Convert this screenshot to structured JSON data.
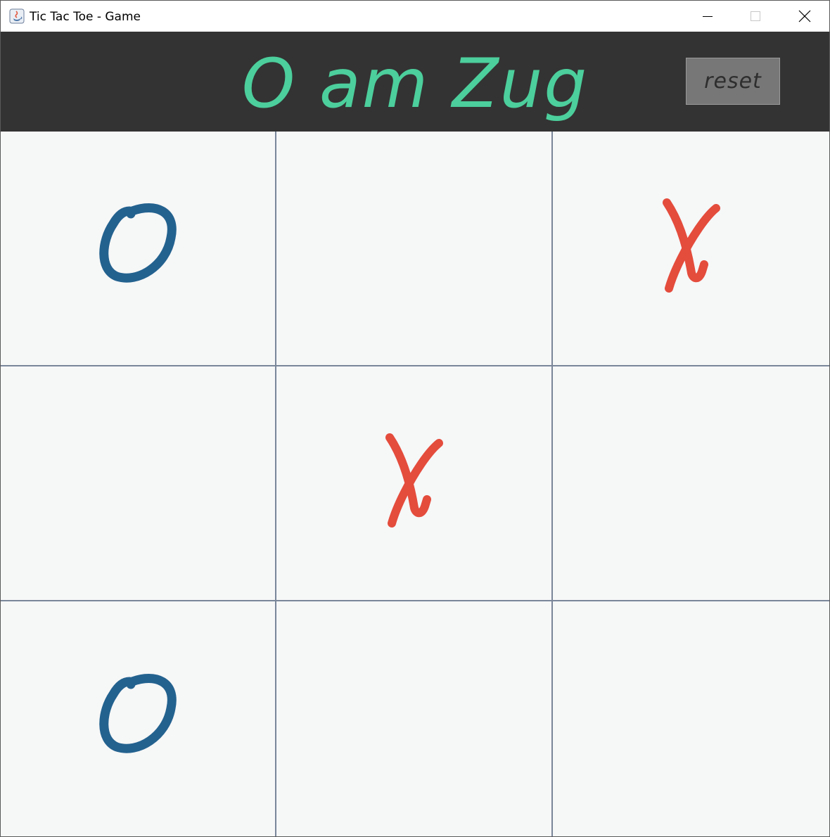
{
  "window": {
    "title": "Tic Tac Toe - Game",
    "controls": [
      "minimize",
      "maximize",
      "close"
    ]
  },
  "header": {
    "status": "O am Zug",
    "reset_label": "reset"
  },
  "colors": {
    "header_bg": "#333333",
    "status_text": "#4ccf9c",
    "reset_bg": "#777777",
    "cell_bg": "#f6f7f7",
    "grid_line": "#7a8699",
    "o_mark": "#23628f",
    "x_mark": "#e44c3c"
  },
  "board": {
    "cells": [
      "O",
      "",
      "X",
      "",
      "X",
      "",
      "O",
      "",
      ""
    ]
  }
}
